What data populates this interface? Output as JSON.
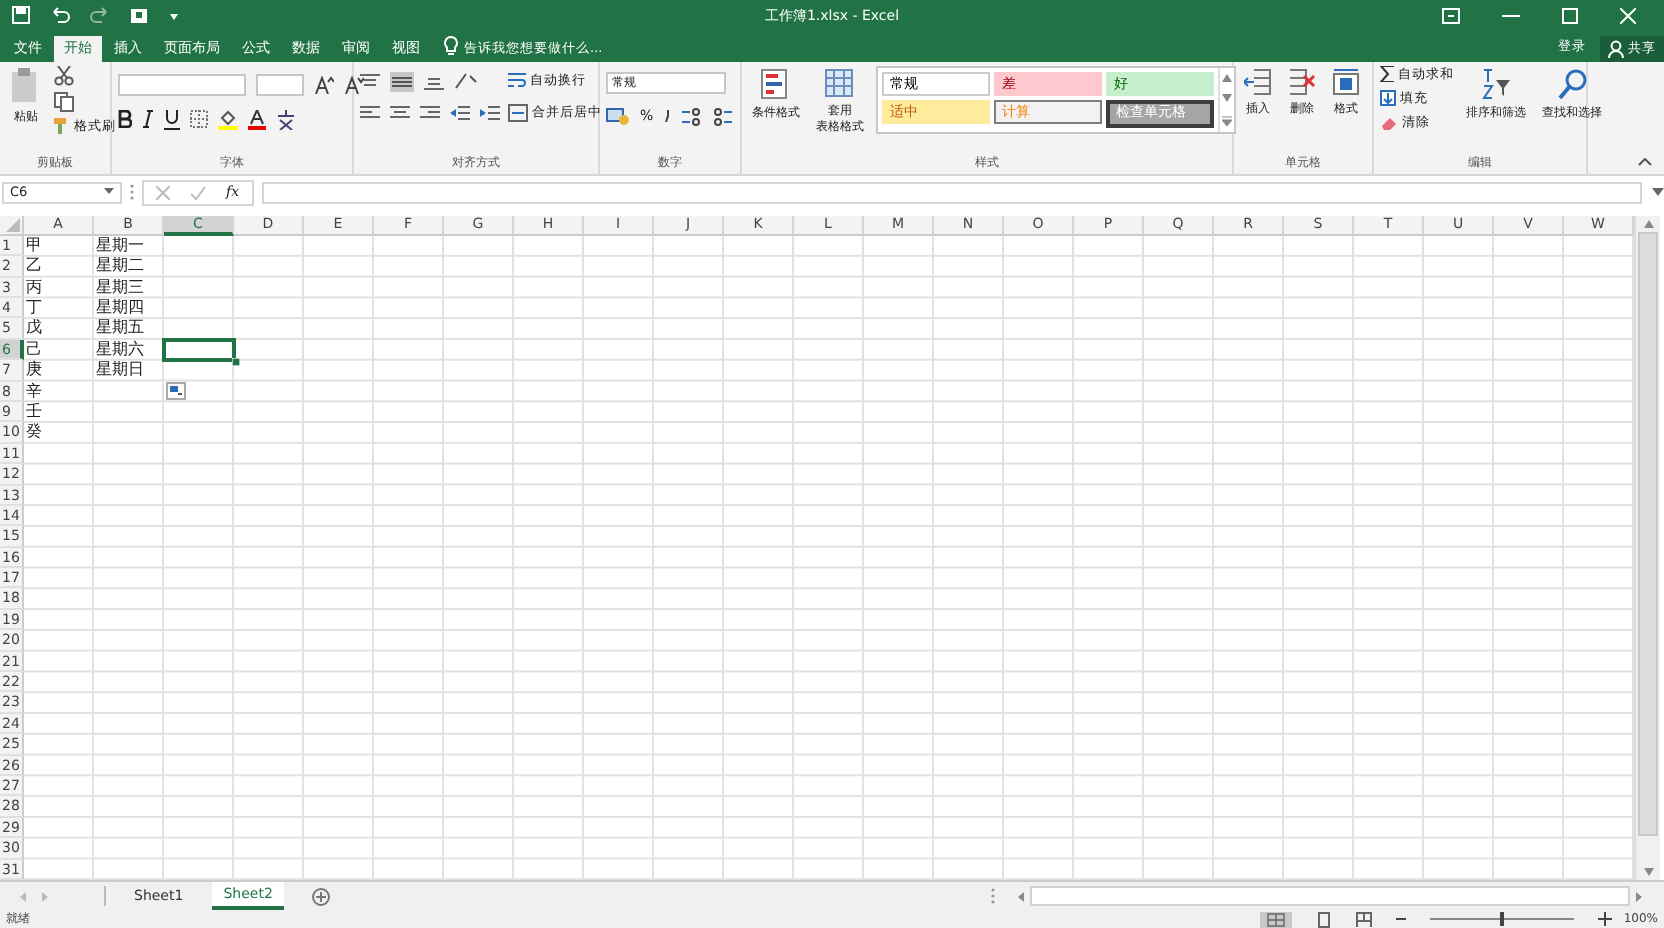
{
  "window": {
    "title": "工作簿1.xlsx - Excel"
  },
  "account": {
    "sign_in": "登录",
    "share": "共享"
  },
  "tabs": [
    {
      "label": "文件",
      "selected": false
    },
    {
      "label": "开始",
      "selected": true
    },
    {
      "label": "插入",
      "selected": false
    },
    {
      "label": "页面布局",
      "selected": false
    },
    {
      "label": "公式",
      "selected": false
    },
    {
      "label": "数据",
      "selected": false
    },
    {
      "label": "审阅",
      "selected": false
    },
    {
      "label": "视图",
      "selected": false
    }
  ],
  "tell_me": {
    "placeholder": "告诉我您想要做什么..."
  },
  "ribbon": {
    "clipboard": {
      "paste": "粘贴",
      "format_painter": "格式刷",
      "label": "剪贴板"
    },
    "font": {
      "label": "字体"
    },
    "alignment": {
      "wrap_text": "自动换行",
      "merge_center": "合并后居中",
      "label": "对齐方式"
    },
    "number": {
      "format": "常规",
      "percent": "%",
      "label": "数字"
    },
    "styles": {
      "conditional_formatting": "条件格式",
      "format_as_table": [
        "套用",
        "表格格式"
      ],
      "cell_styles": [
        {
          "label": "常规",
          "kind": "normal"
        },
        {
          "label": "差",
          "kind": "bad"
        },
        {
          "label": "好",
          "kind": "good"
        },
        {
          "label": "适中",
          "kind": "neutral"
        },
        {
          "label": "计算",
          "kind": "calculation"
        },
        {
          "label": "检查单元格",
          "kind": "check"
        }
      ],
      "label": "样式"
    },
    "cells": {
      "buttons": [
        {
          "label": "插入",
          "kind": "insert"
        },
        {
          "label": "删除",
          "kind": "delete"
        },
        {
          "label": "格式",
          "kind": "format"
        }
      ],
      "label": "单元格"
    },
    "editing": {
      "autosum": "自动求和",
      "fill": "填充",
      "clear": "清除",
      "sort_filter": "排序和筛选",
      "find_select": "查找和选择",
      "label": "编辑"
    }
  },
  "formula_bar": {
    "name_box": "C6",
    "function_label": "fx"
  },
  "sheet": {
    "columns": [
      {
        "label": "A",
        "selected": false
      },
      {
        "label": "B",
        "selected": false
      },
      {
        "label": "C",
        "selected": true
      },
      {
        "label": "D",
        "selected": false
      },
      {
        "label": "E",
        "selected": false
      },
      {
        "label": "F",
        "selected": false
      },
      {
        "label": "G",
        "selected": false
      },
      {
        "label": "H",
        "selected": false
      },
      {
        "label": "I",
        "selected": false
      },
      {
        "label": "J",
        "selected": false
      },
      {
        "label": "K",
        "selected": false
      },
      {
        "label": "L",
        "selected": false
      },
      {
        "label": "M",
        "selected": false
      },
      {
        "label": "N",
        "selected": false
      },
      {
        "label": "O",
        "selected": false
      },
      {
        "label": "P",
        "selected": false
      },
      {
        "label": "Q",
        "selected": false
      },
      {
        "label": "R",
        "selected": false
      },
      {
        "label": "S",
        "selected": false
      },
      {
        "label": "T",
        "selected": false
      },
      {
        "label": "U",
        "selected": false
      },
      {
        "label": "V",
        "selected": false
      },
      {
        "label": "W",
        "selected": false
      }
    ],
    "rows": [
      {
        "label": "1",
        "selected": false,
        "cells": [
          "甲",
          "星期一"
        ]
      },
      {
        "label": "2",
        "selected": false,
        "cells": [
          "乙",
          "星期二"
        ]
      },
      {
        "label": "3",
        "selected": false,
        "cells": [
          "丙",
          "星期三"
        ]
      },
      {
        "label": "4",
        "selected": false,
        "cells": [
          "丁",
          "星期四"
        ]
      },
      {
        "label": "5",
        "selected": false,
        "cells": [
          "戊",
          "星期五"
        ]
      },
      {
        "label": "6",
        "selected": true,
        "cells": [
          "己",
          "星期六"
        ]
      },
      {
        "label": "7",
        "selected": false,
        "cells": [
          "庚",
          "星期日"
        ]
      },
      {
        "label": "8",
        "selected": false,
        "cells": [
          "辛"
        ]
      },
      {
        "label": "9",
        "selected": false,
        "cells": [
          "壬"
        ]
      },
      {
        "label": "10",
        "selected": false,
        "cells": [
          "癸"
        ]
      },
      {
        "label": "11",
        "selected": false
      },
      {
        "label": "12",
        "selected": false
      },
      {
        "label": "13",
        "selected": false
      },
      {
        "label": "14",
        "selected": false
      },
      {
        "label": "15",
        "selected": false
      },
      {
        "label": "16",
        "selected": false
      },
      {
        "label": "17",
        "selected": false
      },
      {
        "label": "18",
        "selected": false
      },
      {
        "label": "19",
        "selected": false
      },
      {
        "label": "20",
        "selected": false
      },
      {
        "label": "21",
        "selected": false
      },
      {
        "label": "22",
        "selected": false
      },
      {
        "label": "23",
        "selected": false
      },
      {
        "label": "24",
        "selected": false
      },
      {
        "label": "25",
        "selected": false
      },
      {
        "label": "26",
        "selected": false
      },
      {
        "label": "27",
        "selected": false
      },
      {
        "label": "28",
        "selected": false
      },
      {
        "label": "29",
        "selected": false
      },
      {
        "label": "30",
        "selected": false
      },
      {
        "label": "31",
        "selected": false
      }
    ]
  },
  "sheet_tabs": [
    {
      "label": "Sheet1",
      "selected": false
    },
    {
      "label": "Sheet2",
      "selected": true
    }
  ],
  "status_bar": {
    "text": "就绪",
    "zoom": "100%",
    "zoom_level": {
      "level": 0.5
    }
  }
}
